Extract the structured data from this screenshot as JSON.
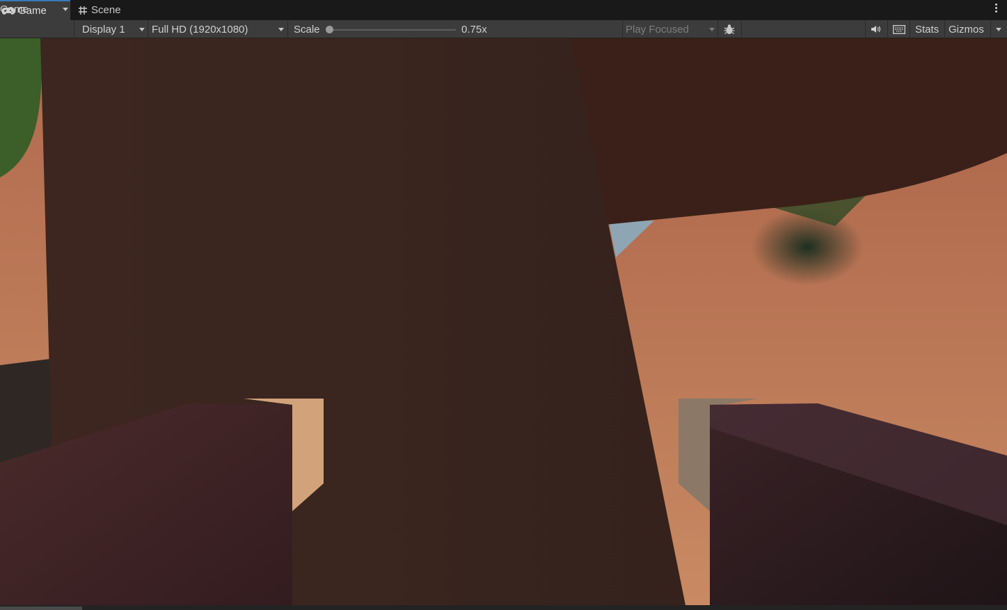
{
  "tabs": [
    {
      "label": "Game",
      "icon": "gamepad-icon",
      "active": true
    },
    {
      "label": "Scene",
      "icon": "grid-icon",
      "active": false
    }
  ],
  "toolbar": {
    "view_mode": "Game",
    "display": "Display 1",
    "resolution": "Full HD (1920x1080)",
    "scale_label": "Scale",
    "scale_value": "0.75x",
    "scale_fraction": 0.0,
    "play_mode": "Play Focused",
    "stats_label": "Stats",
    "gizmos_label": "Gizmos"
  },
  "icons": {
    "bug": "bug-icon",
    "audio": "audio-icon",
    "keyboard": "keyboard-icon",
    "more": "more-vertical-icon"
  },
  "colors": {
    "accent": "#3a79bb",
    "panel": "#3c3c3c",
    "tabbar": "#191919"
  }
}
